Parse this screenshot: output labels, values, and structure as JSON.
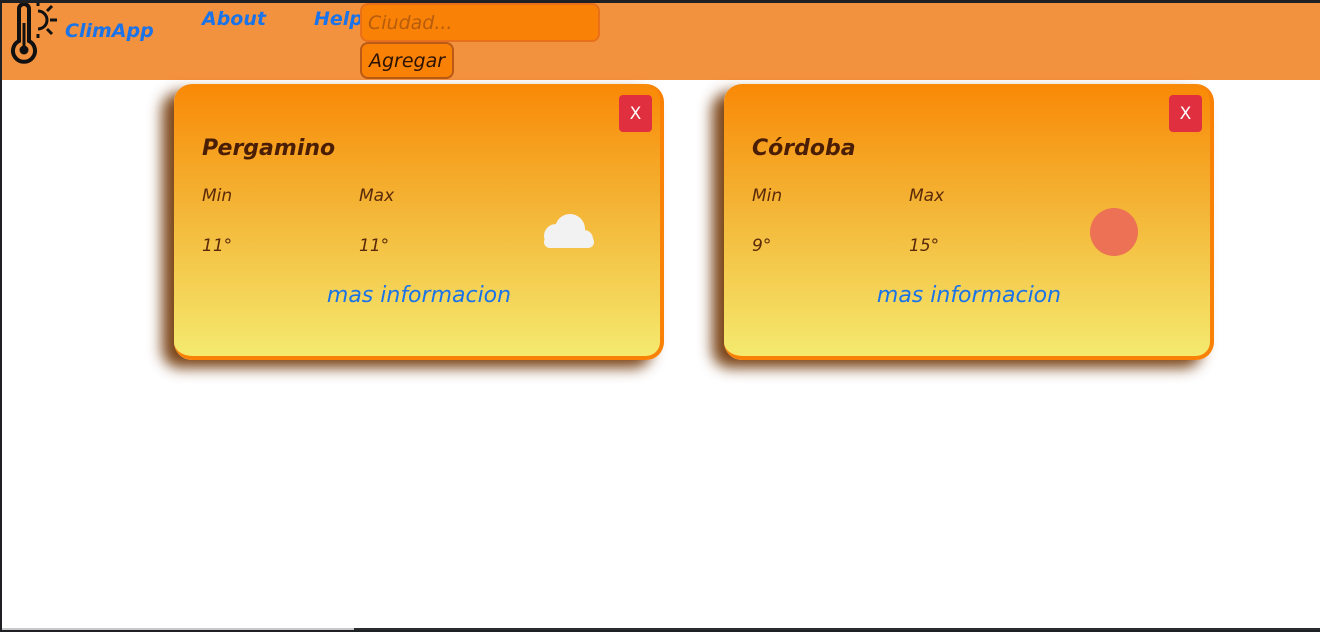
{
  "navbar": {
    "logo_icon": "thermometer-sun-icon",
    "brand": "ClimApp",
    "links": [
      {
        "label": "About"
      },
      {
        "label": "Help"
      }
    ],
    "search": {
      "placeholder": "Ciudad...",
      "value": ""
    },
    "add_label": "Agregar"
  },
  "cards": [
    {
      "city": "Pergamino",
      "close_label": "X",
      "min_label": "Min",
      "max_label": "Max",
      "min": "11°",
      "max": "11°",
      "icon": "cloud-icon",
      "more_label": "mas informacion"
    },
    {
      "city": "Córdoba",
      "close_label": "X",
      "min_label": "Min",
      "max_label": "Max",
      "min": "9°",
      "max": "15°",
      "icon": "sun-icon",
      "more_label": "mas informacion"
    }
  ],
  "colors": {
    "navbar": "#f3923e",
    "accent_orange": "#f98206",
    "link_blue": "#1a73e8",
    "close_red": "#e0303f",
    "sun": "#ec7155",
    "cloud": "#f2f2f2"
  }
}
